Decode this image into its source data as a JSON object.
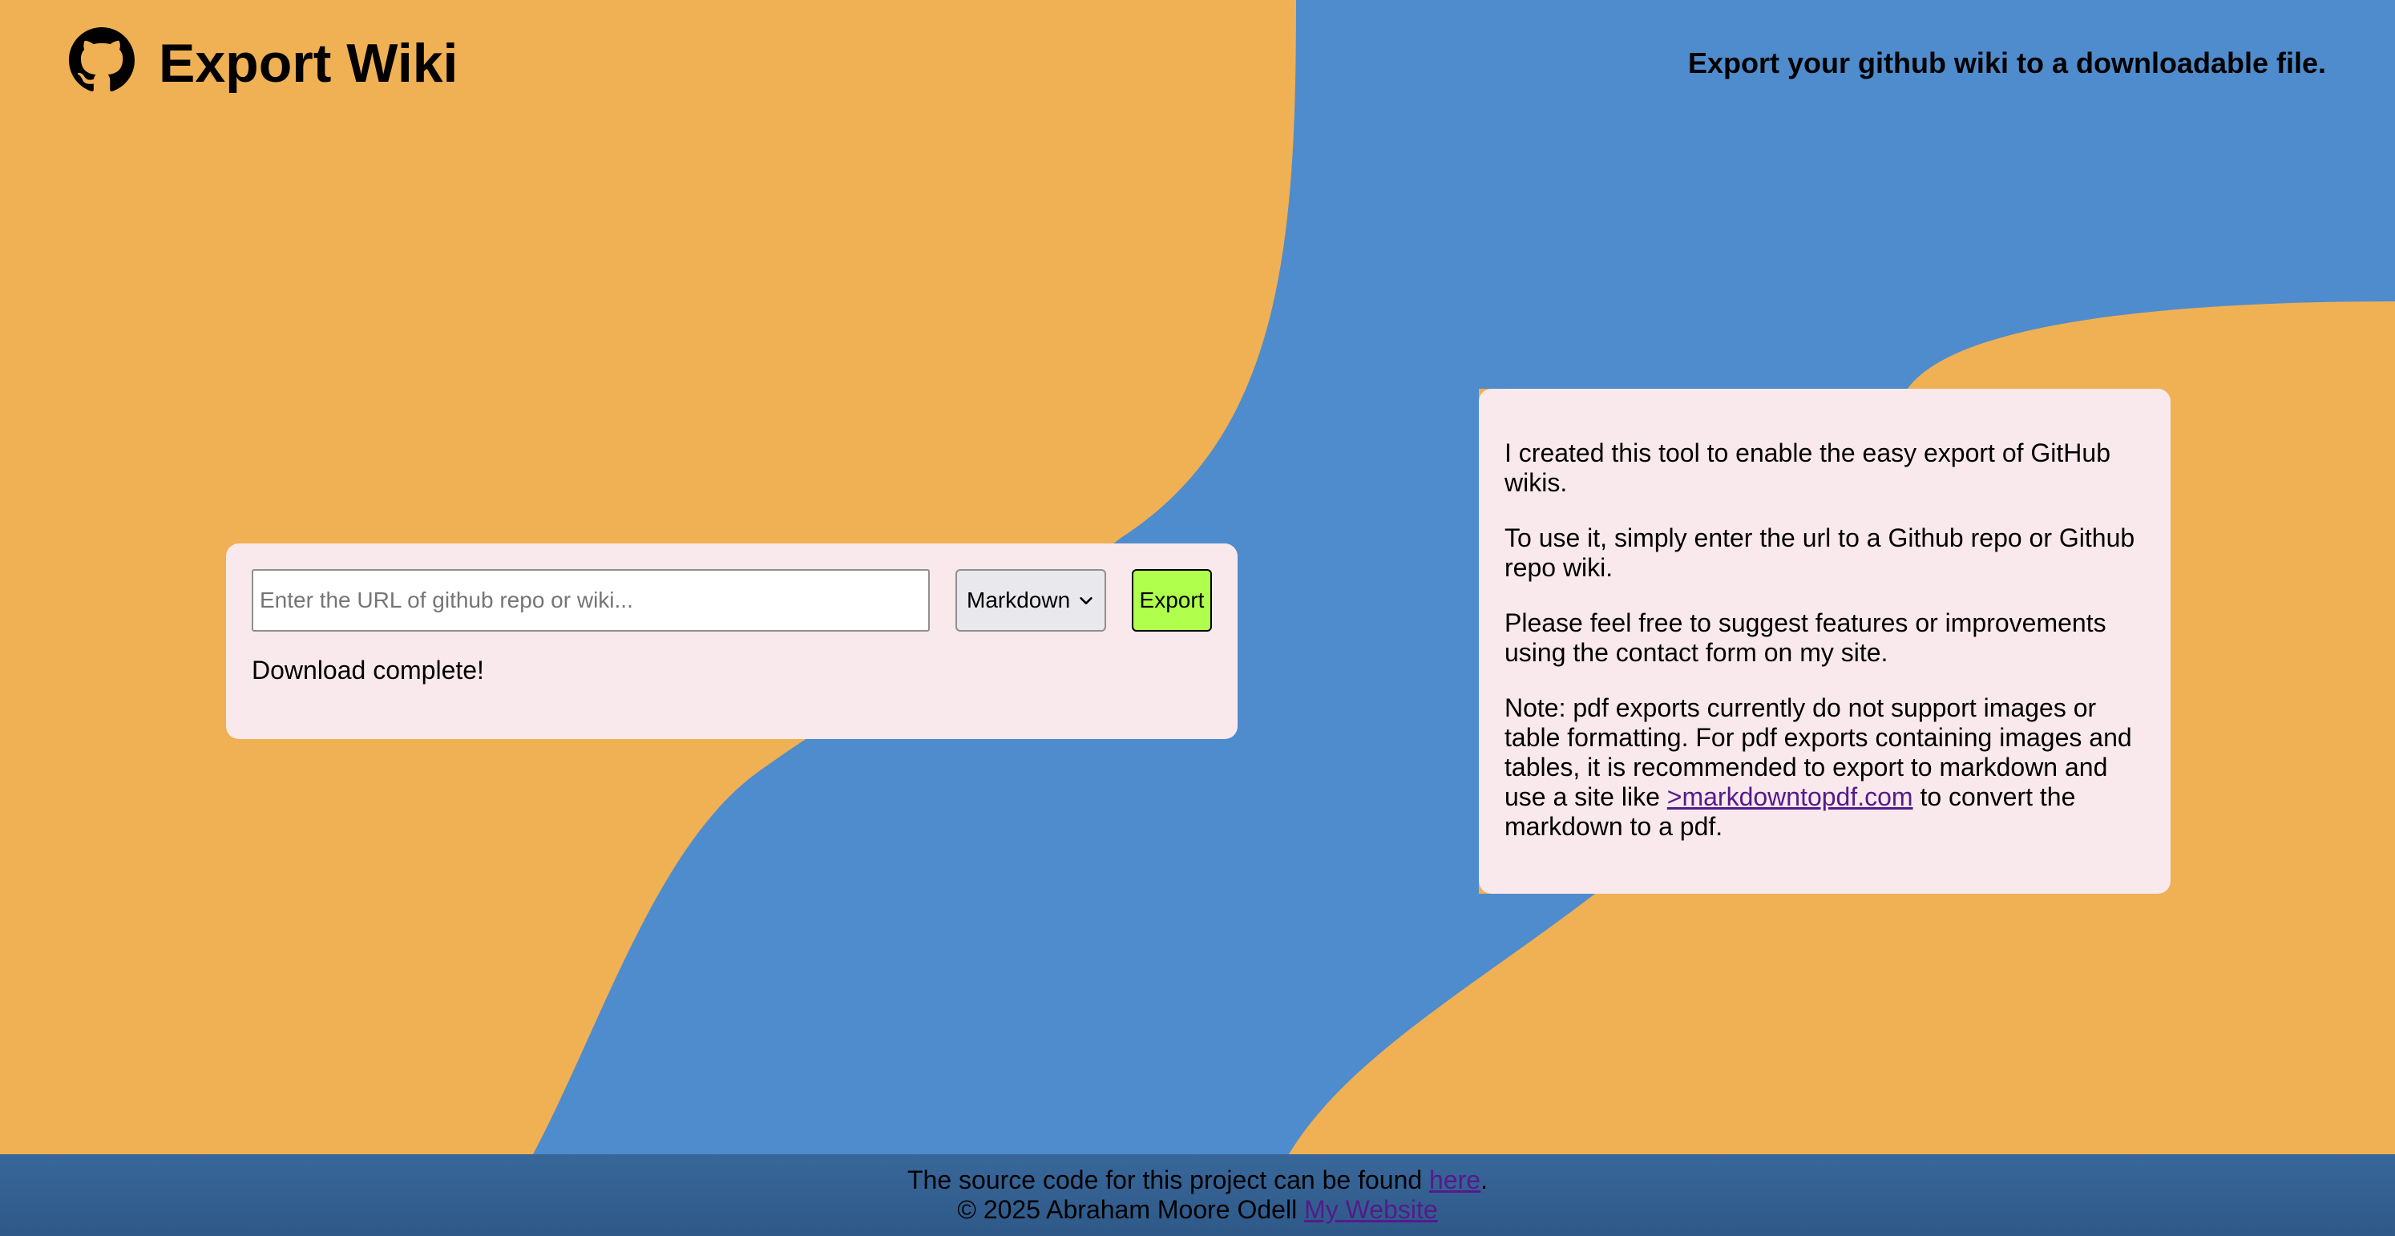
{
  "header": {
    "title": "Export Wiki",
    "tagline": "Export your github wiki to a downloadable file."
  },
  "export_form": {
    "url_placeholder": "Enter the URL of github repo or wiki...",
    "url_value": "",
    "format_selected": "Markdown",
    "export_label": "Export",
    "status": "Download complete!"
  },
  "info": {
    "p1": "I created this tool to enable the easy export of GitHub wikis.",
    "p2": "To use it, simply enter the url to a Github repo or Github repo wiki.",
    "p3": "Please feel free to suggest features or improvements using the contact form on my site.",
    "p4_before": "Note: pdf exports currently do not support images or table formatting. For pdf exports containing images and tables, it is recommended to export to markdown and use a site like ",
    "p4_link": ">markdowntopdf.com",
    "p4_after": " to convert the markdown to a pdf."
  },
  "footer": {
    "line1_before": "The source code for this project can be found ",
    "line1_link": "here",
    "line1_after": ".",
    "line2_before": "© 2025 Abraham Moore Odell ",
    "line2_link": "My Website"
  },
  "colors": {
    "orange": "#f0b054",
    "blue": "#4f8ccd",
    "card": "#fae9ec",
    "footer": "#34628f",
    "export_button": "#b0ff4c",
    "link": "#551a8b"
  },
  "icons": {
    "logo": "github-icon",
    "select": "chevron-down-icon"
  }
}
